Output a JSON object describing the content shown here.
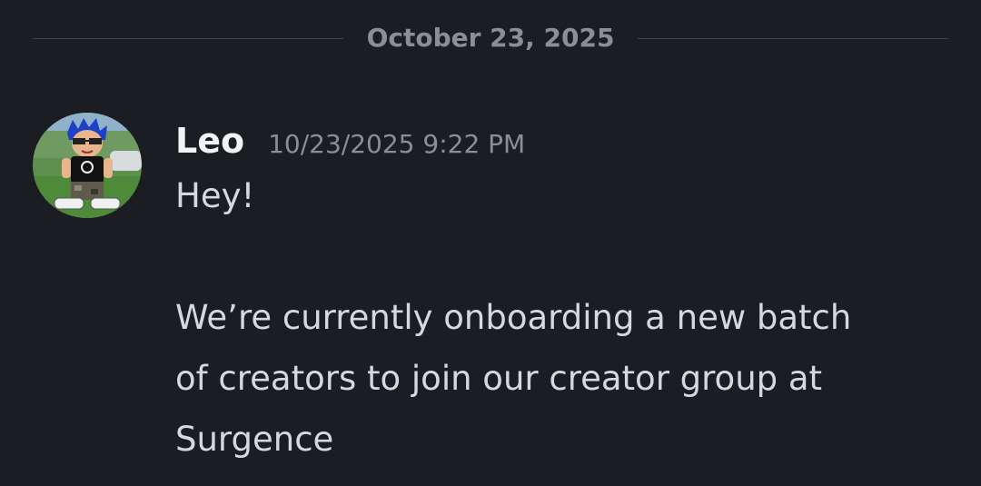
{
  "divider": {
    "date": "October 23, 2025"
  },
  "message": {
    "author": "Leo",
    "timestamp": "10/23/2025 9:22 PM",
    "avatar_icon": "cartoon-avatar-icon",
    "lines": [
      "Hey!",
      "We’re currently onboarding a new batch",
      "of creators to join our creator group at",
      "Surgence"
    ]
  },
  "colors": {
    "background": "#1c1d22",
    "divider_line": "#42444c",
    "muted_text": "#8b8e97",
    "username": "#f2f3f5",
    "message_text": "#d6d8dd"
  }
}
